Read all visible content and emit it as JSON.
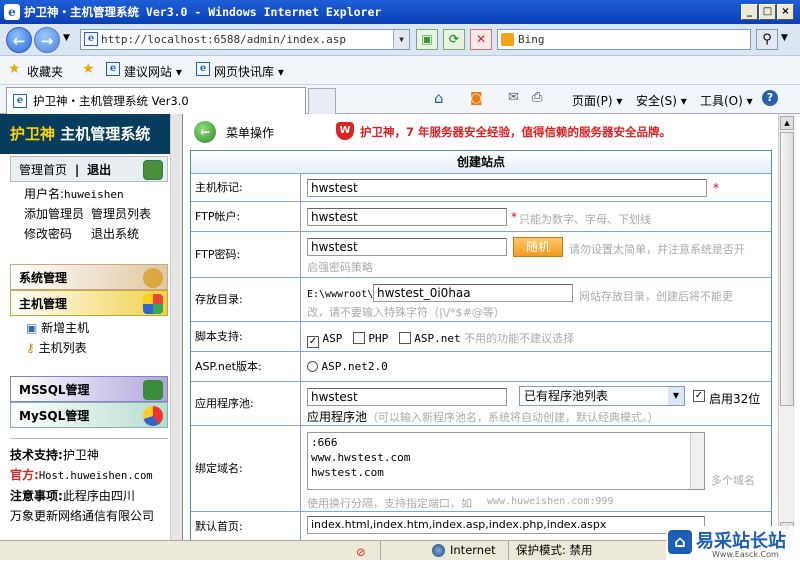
{
  "window": {
    "title": "护卫神・主机管理系统 Ver3.0 - Windows Internet Explorer"
  },
  "nav": {
    "address": "http://localhost:6588/admin/index.asp",
    "search_placeholder": "Bing"
  },
  "favbar": {
    "favorites": "收藏夹",
    "suggested": "建议网站 ▾",
    "webslice": "网页快讯库 ▾"
  },
  "tab": {
    "title": "护卫神・主机管理系统 Ver3.0"
  },
  "cmd": {
    "page": "页面(P) ▾",
    "safety": "安全(S) ▾",
    "tools": "工具(O) ▾"
  },
  "sidebar": {
    "brand_a": "护卫神",
    "brand_b": " 主机管理系统",
    "home": "管理首页",
    "sep": "|",
    "logout": "退出",
    "user_label": "用户名:",
    "user_value": "huweishen",
    "add_admin": "添加管理员",
    "admin_list": "管理员列表",
    "change_pwd": "修改密码",
    "exit_sys": "退出系统",
    "sys_mgmt": "系统管理",
    "host_mgmt": "主机管理",
    "add_host": "新增主机",
    "host_list": "主机列表",
    "mssql": "MSSQL管理",
    "mysql": "MySQL管理",
    "support_label": "技术支持:",
    "support_value": "护卫神",
    "site_label": "官方:",
    "site_value": "Host.huweishen.com",
    "note_label": "注意事项:",
    "note_value": "此程序由四川",
    "note_value2": "万象更新网络通信有限公司"
  },
  "main": {
    "menu_label": "菜单操作",
    "slogan": "护卫神，7 年服务器安全经验，值得信赖的服务器安全品牌。",
    "form_title": "创建站点",
    "host_label": "主机标记:",
    "host_value": "hwstest",
    "star": "*",
    "ftp_user_label": "FTP帐户:",
    "ftp_user_value": "hwstest",
    "ftp_user_hint": "只能为数字、字母、下划线",
    "ftp_pwd_label": "FTP密码:",
    "ftp_pwd_value": "hwstest",
    "random_btn": "随机",
    "ftp_pwd_hint": "请勿设置太简单，并注意系统是否开",
    "ftp_pwd_hint2": "启强密码策略",
    "dir_label": "存放目录:",
    "dir_prefix": "E:\\wwwroot\\",
    "dir_value": "hwstest_0i0haa",
    "dir_hint": "网站存放目录，创建后将不能更",
    "dir_hint2": "改，请不要输入特殊字符（|\\/*$#@等）",
    "script_label": "脚本支持:",
    "opt_asp": "ASP",
    "opt_php": "PHP",
    "opt_aspnet": "ASP.net",
    "script_hint": "不用的功能不建议选择",
    "aspnet_label": "ASP.net版本:",
    "aspnet_opt": "ASP.net2.0",
    "pool_label": "应用程序池:",
    "pool_value": "hwstest",
    "pool_select": "已有程序池列表",
    "pool_32": "启用32位",
    "pool_sub": "应用程序池",
    "pool_hint": "（可以输入新程序池名，系统将自动创建，默认经典模式。）",
    "domain_label": "绑定域名:",
    "domain_lines": [
      ":666",
      "www.hwstest.com",
      "hwstest.com"
    ],
    "domain_hint": "使用换行分隔，支持指定端口，如",
    "domain_example": "www.huweishen.com:999",
    "domain_multi": "多个域名",
    "default_label": "默认首页:",
    "default_value": "index.html,index.htm,index.asp,index.php,index.aspx"
  },
  "status": {
    "zone": "Internet",
    "mode": "保护模式: 禁用"
  },
  "watermark": {
    "text": "易采站长站",
    "url": "Www.Easck.Com"
  }
}
